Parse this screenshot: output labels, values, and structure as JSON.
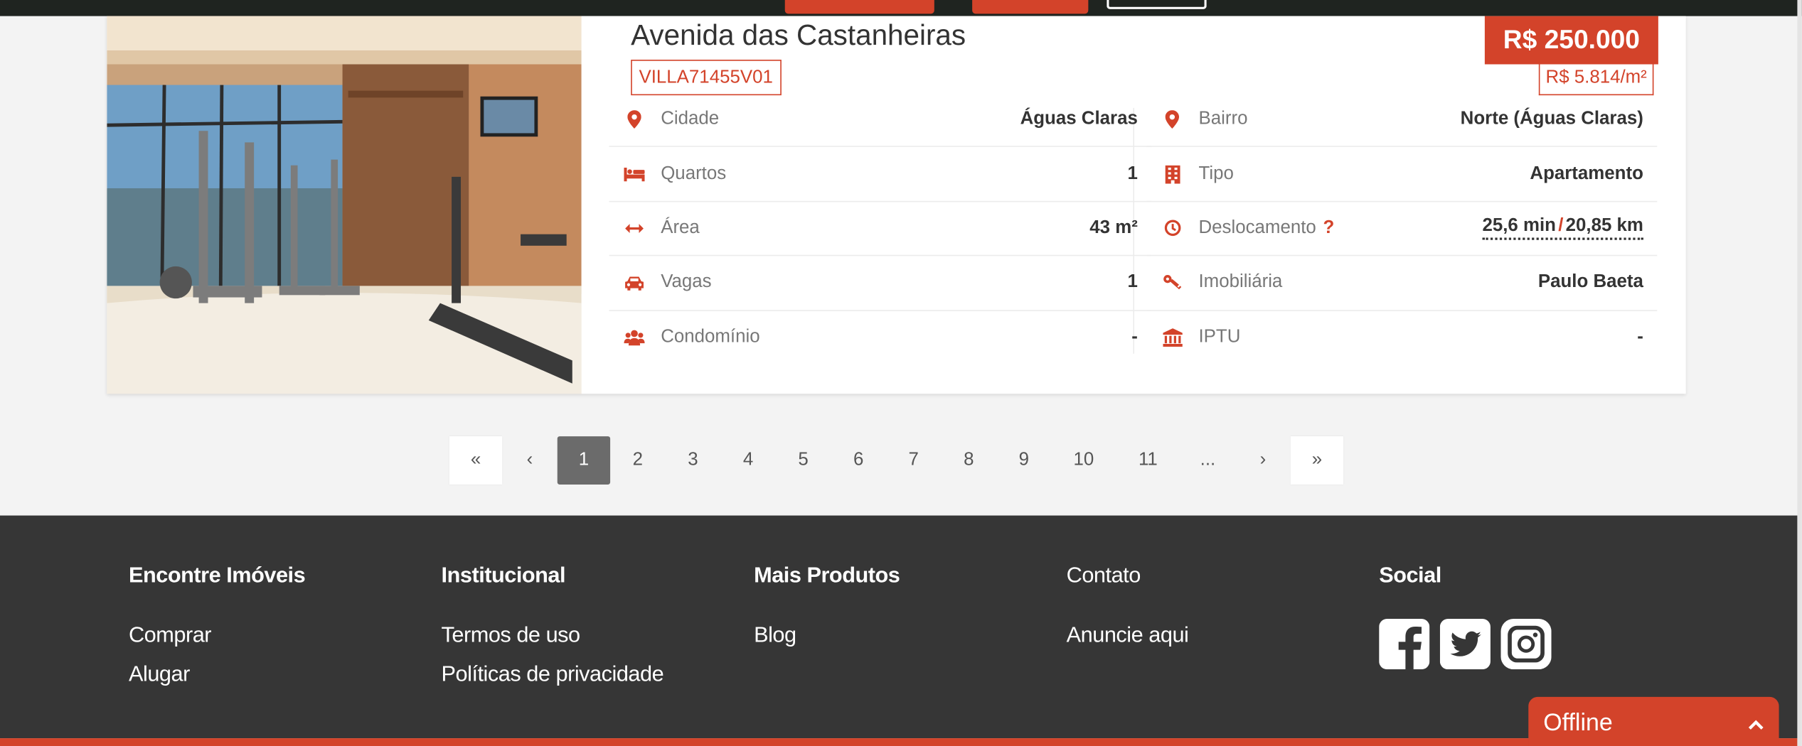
{
  "listing": {
    "title": "Avenida das Castanheiras",
    "code": "VILLA71455V01",
    "price": "R$ 250.000",
    "price_per_m2": "R$ 5.814/m²",
    "left": [
      {
        "icon": "map-pin-icon",
        "label": "Cidade",
        "value": "Águas Claras"
      },
      {
        "icon": "bed-icon",
        "label": "Quartos",
        "value": "1"
      },
      {
        "icon": "arrows-horizontal-icon",
        "label": "Área",
        "value": "43 m²"
      },
      {
        "icon": "car-icon",
        "label": "Vagas",
        "value": "1"
      },
      {
        "icon": "users-icon",
        "label": "Condomínio",
        "value": "-"
      }
    ],
    "right": [
      {
        "icon": "map-pin-icon",
        "label": "Bairro",
        "value": "Norte (Águas Claras)"
      },
      {
        "icon": "building-icon",
        "label": "Tipo",
        "value": "Apartamento"
      },
      {
        "icon": "clock-icon",
        "label": "Deslocamento",
        "help": "?",
        "value_time": "25,6 min",
        "value_sep": "/",
        "value_dist": "20,85 km"
      },
      {
        "icon": "key-icon",
        "label": "Imobiliária",
        "value": "Paulo Baeta"
      },
      {
        "icon": "bank-icon",
        "label": "IPTU",
        "value": "-"
      }
    ]
  },
  "pagination": {
    "first": "«",
    "prev": "‹",
    "pages": [
      "1",
      "2",
      "3",
      "4",
      "5",
      "6",
      "7",
      "8",
      "9",
      "10",
      "11",
      "..."
    ],
    "next": "›",
    "last": "»"
  },
  "footer": {
    "columns": [
      {
        "title": "Encontre Imóveis",
        "links": [
          "Comprar",
          "Alugar"
        ]
      },
      {
        "title": "Institucional",
        "links": [
          "Termos de uso",
          "Políticas de privacidade"
        ]
      },
      {
        "title": "Mais Produtos",
        "links": [
          "Blog"
        ]
      },
      {
        "title": "Contato",
        "links": [
          "Anuncie aqui"
        ]
      },
      {
        "title": "Social",
        "links": []
      }
    ],
    "social_icons": [
      "facebook-icon",
      "twitter-icon",
      "instagram-icon"
    ]
  },
  "chat": {
    "status": "Offline",
    "toggle": "^"
  },
  "colors": {
    "accent": "#d3432a",
    "footer_bg": "#363636",
    "active_page": "#6b6b6b"
  }
}
